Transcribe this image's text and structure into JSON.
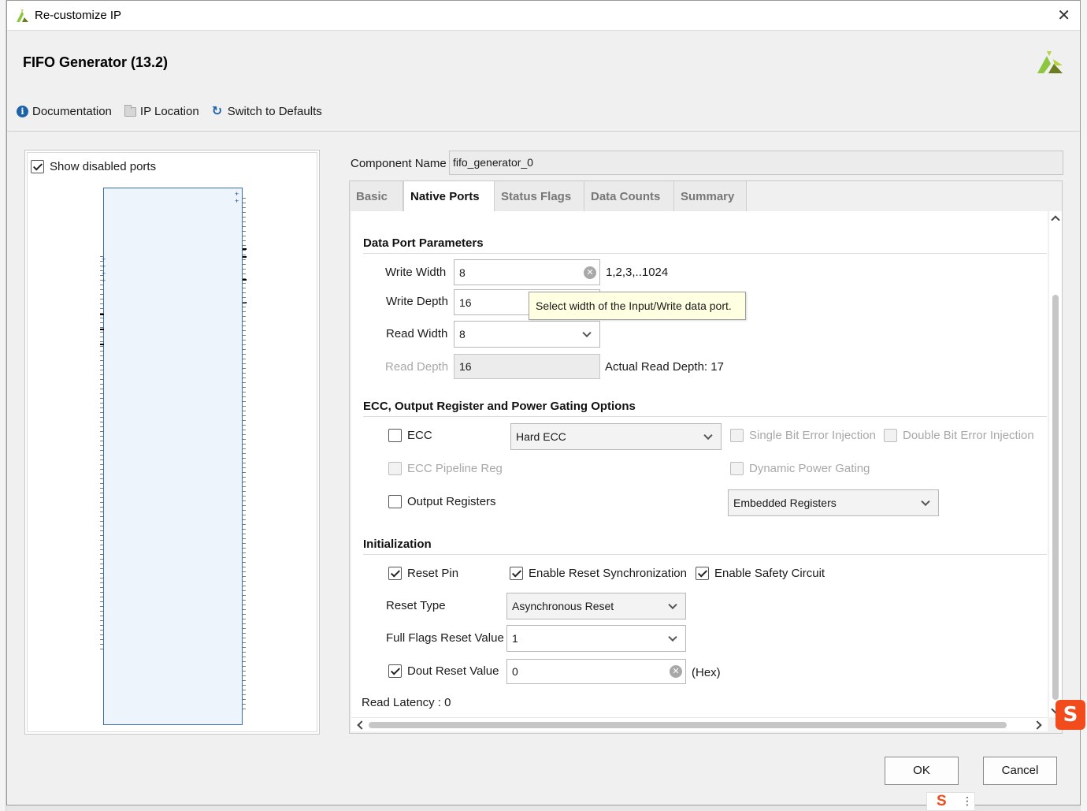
{
  "window": {
    "title": "Re-customize IP",
    "close_glyph": "✕"
  },
  "header": {
    "ip_title": "FIFO Generator (13.2)",
    "toolbar": {
      "documentation": "Documentation",
      "ip_location": "IP Location",
      "switch_defaults": "Switch to Defaults"
    }
  },
  "left_panel": {
    "show_disabled_ports": "Show disabled ports",
    "show_disabled_checked": true
  },
  "component": {
    "label": "Component Name",
    "value": "fifo_generator_0"
  },
  "tabs": [
    {
      "label": "Basic",
      "active": false
    },
    {
      "label": "Native Ports",
      "active": true
    },
    {
      "label": "Status Flags",
      "active": false
    },
    {
      "label": "Data Counts",
      "active": false
    },
    {
      "label": "Summary",
      "active": false
    }
  ],
  "data_port": {
    "title": "Data Port Parameters",
    "write_width_label": "Write Width",
    "write_width_value": "8",
    "write_width_hint": "1,2,3,..1024",
    "write_depth_label": "Write Depth",
    "write_depth_value": "16",
    "read_width_label": "Read Width",
    "read_width_value": "8",
    "read_depth_label": "Read Depth",
    "read_depth_value": "16",
    "actual_read_depth": "Actual Read Depth: 17",
    "tooltip": "Select width of the Input/Write data port."
  },
  "ecc": {
    "title": "ECC, Output Register and Power Gating Options",
    "ecc_label": "ECC",
    "ecc_type": "Hard ECC",
    "single_bit": "Single Bit Error Injection",
    "double_bit": "Double Bit Error Injection",
    "ecc_pipeline": "ECC Pipeline Reg",
    "dynamic_power": "Dynamic Power Gating",
    "output_registers": "Output Registers",
    "output_reg_type": "Embedded Registers"
  },
  "init": {
    "title": "Initialization",
    "reset_pin": "Reset Pin",
    "enable_reset_sync": "Enable Reset Synchronization",
    "enable_safety": "Enable Safety Circuit",
    "reset_type_label": "Reset Type",
    "reset_type_value": "Asynchronous Reset",
    "full_flags_label": "Full Flags Reset Value",
    "full_flags_value": "1",
    "dout_reset_label": "Dout Reset Value",
    "dout_reset_value": "0",
    "hex_suffix": "(Hex)",
    "read_latency": "Read Latency : 0"
  },
  "buttons": {
    "ok": "OK",
    "cancel": "Cancel"
  },
  "ime": {
    "badge": "S"
  },
  "colors": {
    "accent": "#1d62a8",
    "xilinx_green": "#8dc63f",
    "xilinx_olive": "#6b7d1f",
    "ime_orange": "#f24c1d"
  }
}
